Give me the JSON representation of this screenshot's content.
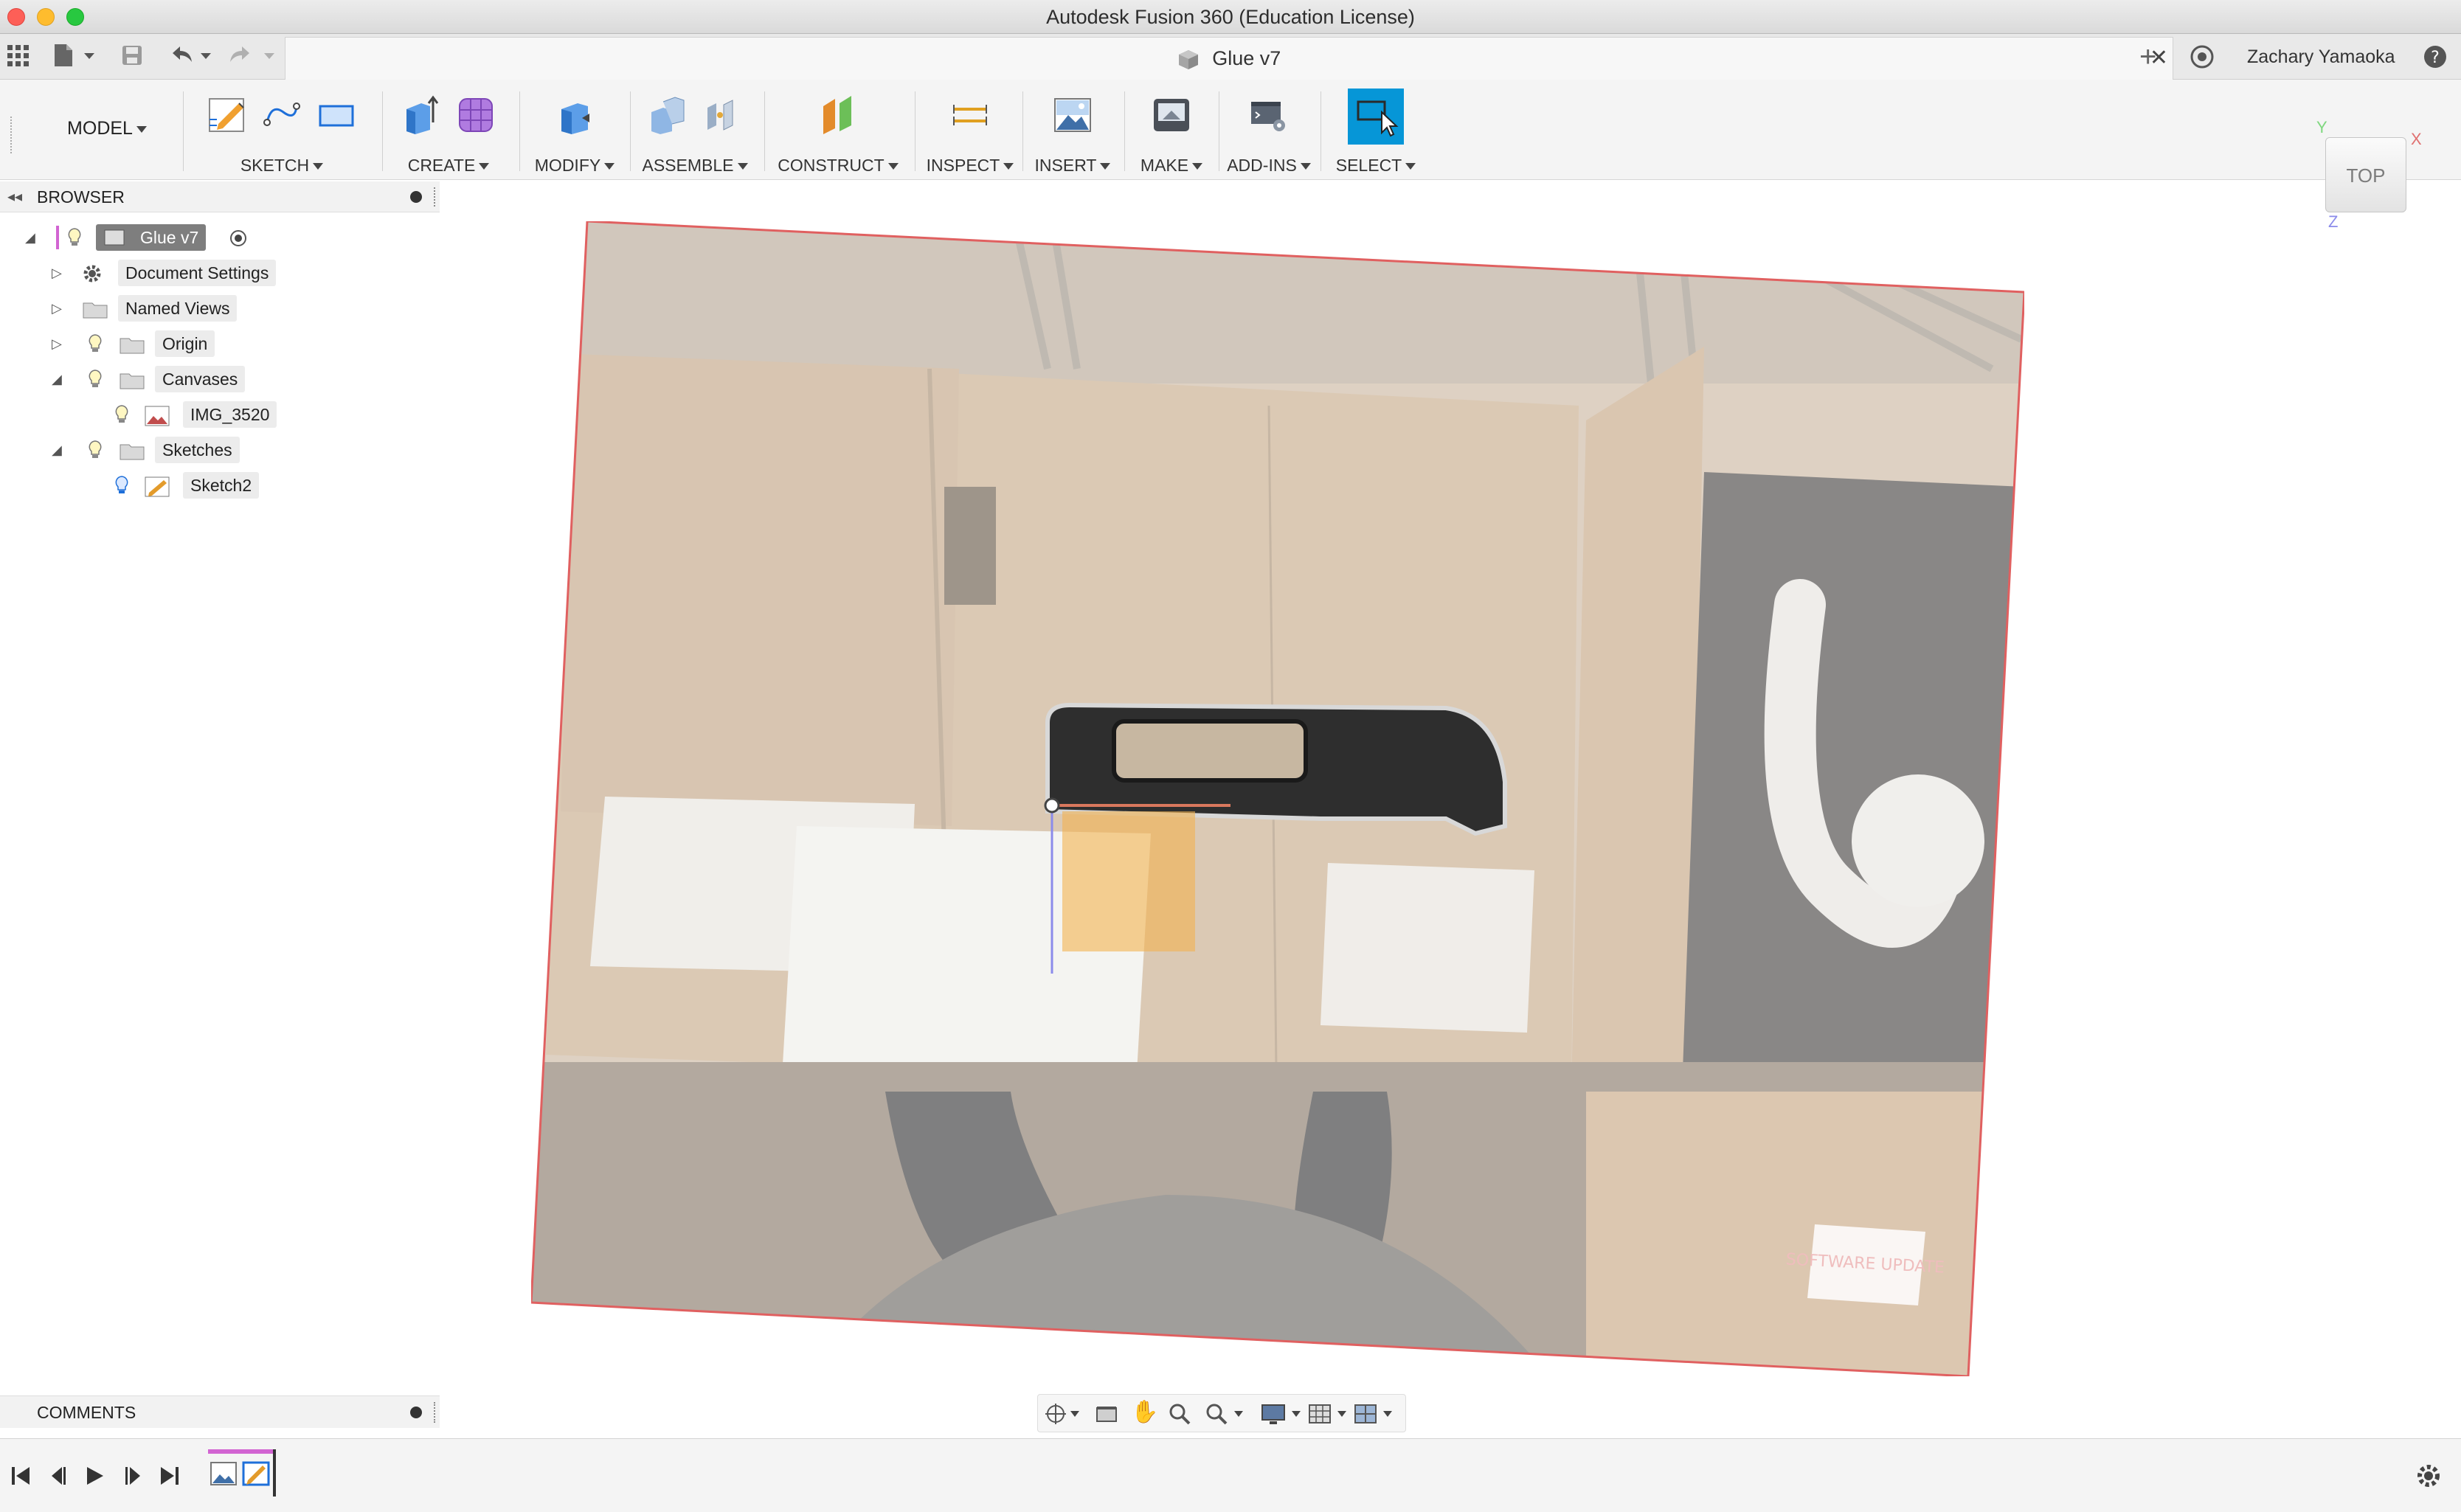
{
  "window": {
    "title": "Autodesk Fusion 360 (Education License)"
  },
  "tabbar": {
    "document_tab": "Glue v7",
    "user": "Zachary Yamaoka"
  },
  "toolbar": {
    "workspace": "MODEL",
    "groups": {
      "sketch": "SKETCH",
      "create": "CREATE",
      "modify": "MODIFY",
      "assemble": "ASSEMBLE",
      "construct": "CONSTRUCT",
      "inspect": "INSPECT",
      "insert": "INSERT",
      "make": "MAKE",
      "addins": "ADD-INS",
      "select": "SELECT"
    }
  },
  "browser": {
    "title": "BROWSER",
    "root": "Glue v7",
    "items": {
      "document_settings": "Document Settings",
      "named_views": "Named Views",
      "origin": "Origin",
      "canvases": "Canvases",
      "canvas_image": "IMG_3520",
      "sketches": "Sketches",
      "sketch": "Sketch2"
    }
  },
  "comments": {
    "title": "COMMENTS"
  },
  "viewcube": {
    "face": "TOP",
    "axis_x": "X",
    "axis_y": "Y",
    "axis_z": "Z"
  },
  "canvas": {
    "sticky_note": "SOFTWARE UPDATE"
  },
  "colors": {
    "accent": "#0696d7",
    "canvas_border": "#e06060",
    "sketch_plane": "#f2b250",
    "axis_x": "#e07070",
    "axis_y": "#7fd77f",
    "axis_z": "#8b8bea"
  },
  "icons": [
    "app-grid-icon",
    "file-icon",
    "save-icon",
    "undo-icon",
    "redo-icon",
    "new-tab-icon",
    "job-status-icon",
    "help-icon",
    "gear-icon"
  ]
}
